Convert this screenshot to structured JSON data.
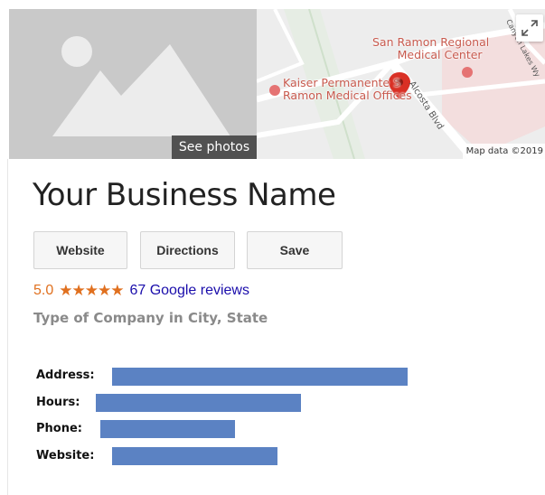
{
  "photos": {
    "see_photos_label": "See photos",
    "icon": "placeholder-image-icon"
  },
  "map": {
    "places": [
      {
        "name": "San Ramon Regional Medical Center"
      },
      {
        "name": "Kaiser Permanente San Ramon Medical Offices"
      }
    ],
    "place_label_1_line1": "San Ramon Regional",
    "place_label_1_line2": "Medical Center",
    "place_label_2_line1": "Kaiser Permanente S",
    "place_label_2_line2": "Ramon Medical Offices",
    "road_1": "Alcosta Blvd",
    "road_2": "Canyon Lakes Wy",
    "attribution": "Map data ©2019",
    "expand_icon": "expand-icon",
    "pin_color": "#d93025"
  },
  "business": {
    "name": "Your Business Name",
    "type": "Type of Company in City, State"
  },
  "actions": {
    "website_label": "Website",
    "directions_label": "Directions",
    "save_label": "Save"
  },
  "rating": {
    "value": "5.0",
    "stars": "★★★★★",
    "reviews_label": "67 Google reviews",
    "stars_color": "#e0701f"
  },
  "info": {
    "address_label": "Address:",
    "hours_label": "Hours:",
    "phone_label": "Phone:",
    "website_label": "Website:",
    "redaction_color": "#5b82c3"
  }
}
